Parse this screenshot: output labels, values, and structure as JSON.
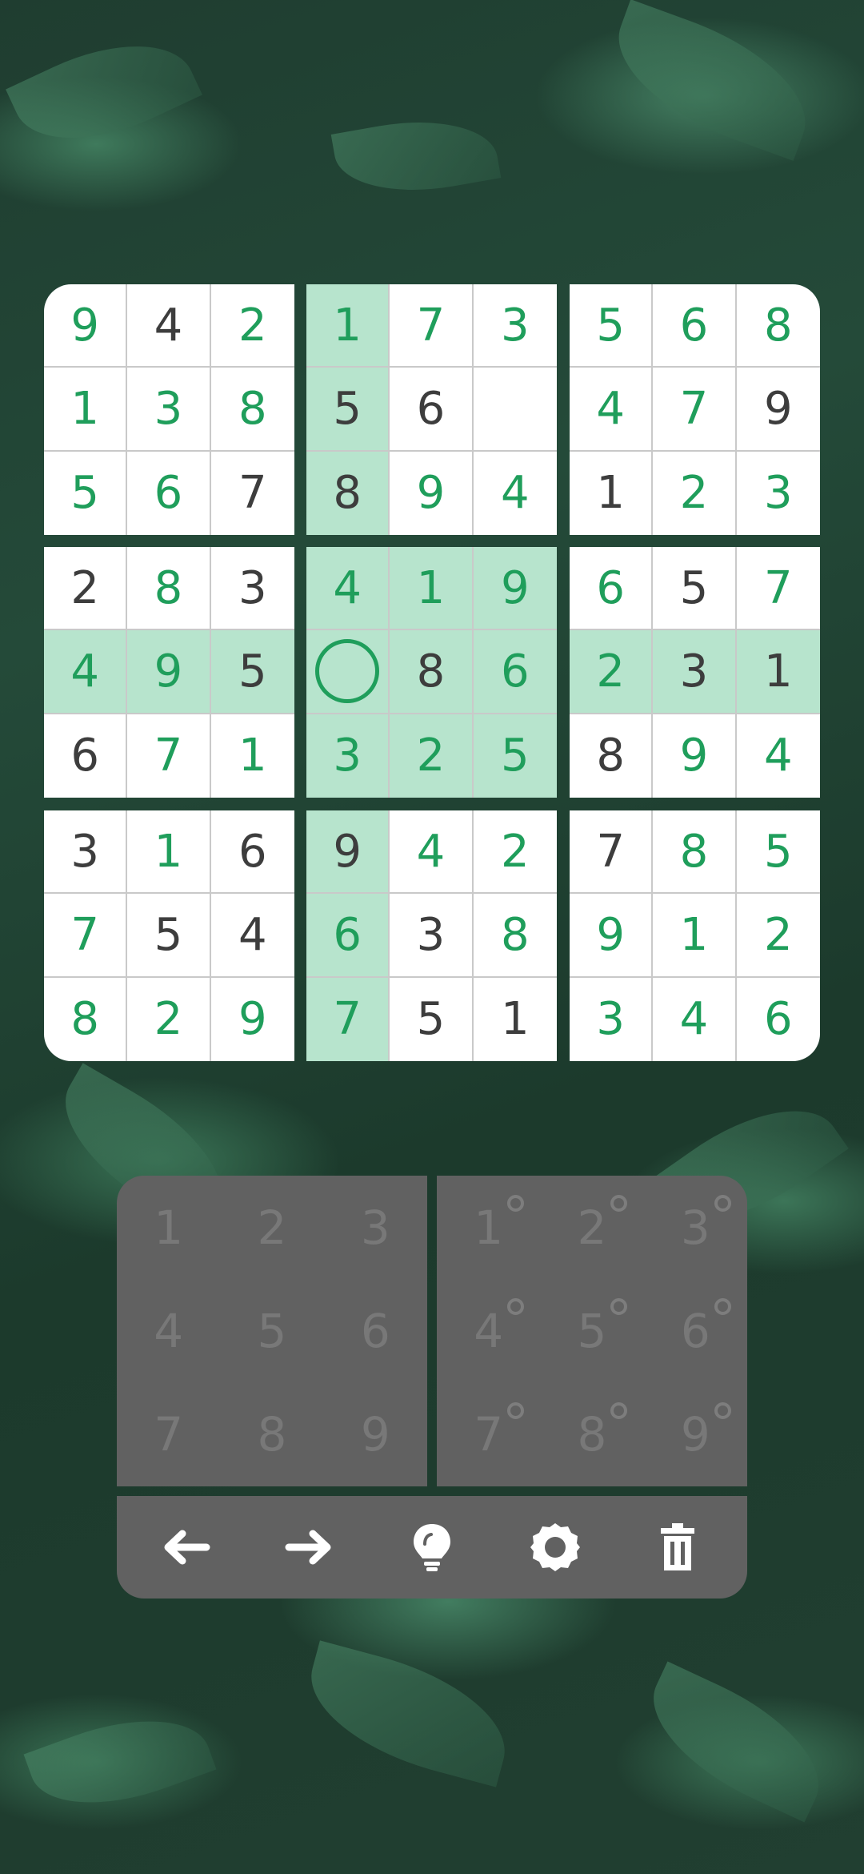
{
  "board": [
    [
      {
        "v": "9",
        "g": true
      },
      {
        "v": "4",
        "g": false
      },
      {
        "v": "2",
        "g": true
      },
      {
        "v": "1",
        "g": true
      },
      {
        "v": "7",
        "g": true
      },
      {
        "v": "3",
        "g": true
      },
      {
        "v": "5",
        "g": true
      },
      {
        "v": "6",
        "g": true
      },
      {
        "v": "8",
        "g": true
      }
    ],
    [
      {
        "v": "1",
        "g": true
      },
      {
        "v": "3",
        "g": true
      },
      {
        "v": "8",
        "g": true
      },
      {
        "v": "5",
        "g": false
      },
      {
        "v": "6",
        "g": false
      },
      {
        "v": "",
        "g": false
      },
      {
        "v": "4",
        "g": true
      },
      {
        "v": "7",
        "g": true
      },
      {
        "v": "9",
        "g": false
      }
    ],
    [
      {
        "v": "5",
        "g": true
      },
      {
        "v": "6",
        "g": true
      },
      {
        "v": "7",
        "g": false
      },
      {
        "v": "8",
        "g": false
      },
      {
        "v": "9",
        "g": true
      },
      {
        "v": "4",
        "g": true
      },
      {
        "v": "1",
        "g": false
      },
      {
        "v": "2",
        "g": true
      },
      {
        "v": "3",
        "g": true
      }
    ],
    [
      {
        "v": "2",
        "g": false
      },
      {
        "v": "8",
        "g": true
      },
      {
        "v": "3",
        "g": false
      },
      {
        "v": "4",
        "g": true
      },
      {
        "v": "1",
        "g": true
      },
      {
        "v": "9",
        "g": true
      },
      {
        "v": "6",
        "g": true
      },
      {
        "v": "5",
        "g": false
      },
      {
        "v": "7",
        "g": true
      }
    ],
    [
      {
        "v": "4",
        "g": true
      },
      {
        "v": "9",
        "g": true
      },
      {
        "v": "5",
        "g": false
      },
      {
        "v": "",
        "g": false
      },
      {
        "v": "8",
        "g": false
      },
      {
        "v": "6",
        "g": true
      },
      {
        "v": "2",
        "g": true
      },
      {
        "v": "3",
        "g": false
      },
      {
        "v": "1",
        "g": false
      }
    ],
    [
      {
        "v": "6",
        "g": false
      },
      {
        "v": "7",
        "g": true
      },
      {
        "v": "1",
        "g": true
      },
      {
        "v": "3",
        "g": true
      },
      {
        "v": "2",
        "g": true
      },
      {
        "v": "5",
        "g": true
      },
      {
        "v": "8",
        "g": false
      },
      {
        "v": "9",
        "g": true
      },
      {
        "v": "4",
        "g": true
      }
    ],
    [
      {
        "v": "3",
        "g": false
      },
      {
        "v": "1",
        "g": true
      },
      {
        "v": "6",
        "g": false
      },
      {
        "v": "9",
        "g": false
      },
      {
        "v": "4",
        "g": true
      },
      {
        "v": "2",
        "g": true
      },
      {
        "v": "7",
        "g": false
      },
      {
        "v": "8",
        "g": true
      },
      {
        "v": "5",
        "g": true
      }
    ],
    [
      {
        "v": "7",
        "g": true
      },
      {
        "v": "5",
        "g": false
      },
      {
        "v": "4",
        "g": false
      },
      {
        "v": "6",
        "g": true
      },
      {
        "v": "3",
        "g": false
      },
      {
        "v": "8",
        "g": true
      },
      {
        "v": "9",
        "g": true
      },
      {
        "v": "1",
        "g": true
      },
      {
        "v": "2",
        "g": true
      }
    ],
    [
      {
        "v": "8",
        "g": true
      },
      {
        "v": "2",
        "g": true
      },
      {
        "v": "9",
        "g": true
      },
      {
        "v": "7",
        "g": true
      },
      {
        "v": "5",
        "g": false
      },
      {
        "v": "1",
        "g": false
      },
      {
        "v": "3",
        "g": true
      },
      {
        "v": "4",
        "g": true
      },
      {
        "v": "6",
        "g": true
      }
    ]
  ],
  "selected": {
    "row": 4,
    "col": 3
  },
  "colors": {
    "given": "#1f9e5b",
    "entered": "#3d3d3d",
    "highlight": "#b7e4cd",
    "pad": "#616161"
  },
  "number_pad": [
    "1",
    "2",
    "3",
    "4",
    "5",
    "6",
    "7",
    "8",
    "9"
  ],
  "notes_pad": [
    "1",
    "2",
    "3",
    "4",
    "5",
    "6",
    "7",
    "8",
    "9"
  ],
  "toolbar": [
    {
      "name": "undo-button",
      "icon": "arrow-left-icon"
    },
    {
      "name": "redo-button",
      "icon": "arrow-right-icon"
    },
    {
      "name": "hint-button",
      "icon": "lightbulb-icon"
    },
    {
      "name": "settings-button",
      "icon": "gear-icon"
    },
    {
      "name": "erase-button",
      "icon": "trash-icon"
    }
  ]
}
